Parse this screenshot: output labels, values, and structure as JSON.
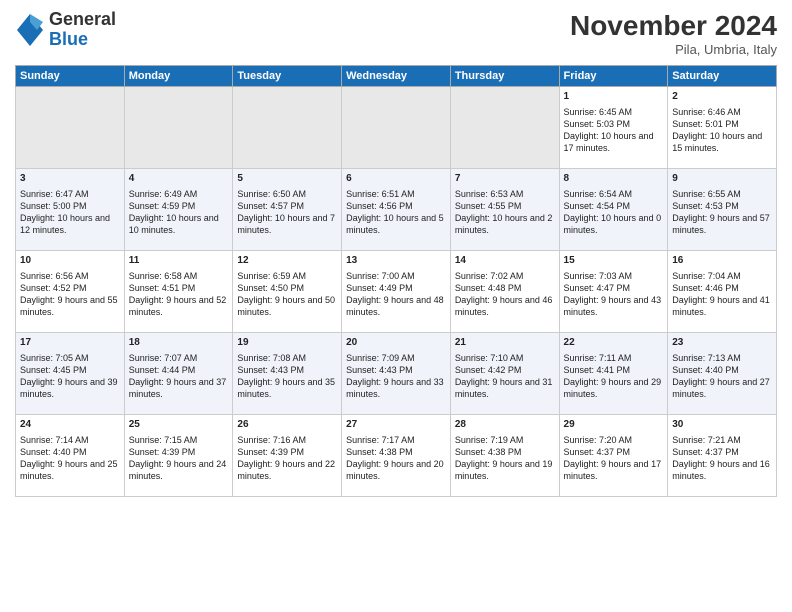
{
  "logo": {
    "general": "General",
    "blue": "Blue"
  },
  "header": {
    "title": "November 2024",
    "location": "Pila, Umbria, Italy"
  },
  "days_of_week": [
    "Sunday",
    "Monday",
    "Tuesday",
    "Wednesday",
    "Thursday",
    "Friday",
    "Saturday"
  ],
  "weeks": [
    [
      {
        "day": "",
        "info": ""
      },
      {
        "day": "",
        "info": ""
      },
      {
        "day": "",
        "info": ""
      },
      {
        "day": "",
        "info": ""
      },
      {
        "day": "",
        "info": ""
      },
      {
        "day": "1",
        "info": "Sunrise: 6:45 AM\nSunset: 5:03 PM\nDaylight: 10 hours and 17 minutes."
      },
      {
        "day": "2",
        "info": "Sunrise: 6:46 AM\nSunset: 5:01 PM\nDaylight: 10 hours and 15 minutes."
      }
    ],
    [
      {
        "day": "3",
        "info": "Sunrise: 6:47 AM\nSunset: 5:00 PM\nDaylight: 10 hours and 12 minutes."
      },
      {
        "day": "4",
        "info": "Sunrise: 6:49 AM\nSunset: 4:59 PM\nDaylight: 10 hours and 10 minutes."
      },
      {
        "day": "5",
        "info": "Sunrise: 6:50 AM\nSunset: 4:57 PM\nDaylight: 10 hours and 7 minutes."
      },
      {
        "day": "6",
        "info": "Sunrise: 6:51 AM\nSunset: 4:56 PM\nDaylight: 10 hours and 5 minutes."
      },
      {
        "day": "7",
        "info": "Sunrise: 6:53 AM\nSunset: 4:55 PM\nDaylight: 10 hours and 2 minutes."
      },
      {
        "day": "8",
        "info": "Sunrise: 6:54 AM\nSunset: 4:54 PM\nDaylight: 10 hours and 0 minutes."
      },
      {
        "day": "9",
        "info": "Sunrise: 6:55 AM\nSunset: 4:53 PM\nDaylight: 9 hours and 57 minutes."
      }
    ],
    [
      {
        "day": "10",
        "info": "Sunrise: 6:56 AM\nSunset: 4:52 PM\nDaylight: 9 hours and 55 minutes."
      },
      {
        "day": "11",
        "info": "Sunrise: 6:58 AM\nSunset: 4:51 PM\nDaylight: 9 hours and 52 minutes."
      },
      {
        "day": "12",
        "info": "Sunrise: 6:59 AM\nSunset: 4:50 PM\nDaylight: 9 hours and 50 minutes."
      },
      {
        "day": "13",
        "info": "Sunrise: 7:00 AM\nSunset: 4:49 PM\nDaylight: 9 hours and 48 minutes."
      },
      {
        "day": "14",
        "info": "Sunrise: 7:02 AM\nSunset: 4:48 PM\nDaylight: 9 hours and 46 minutes."
      },
      {
        "day": "15",
        "info": "Sunrise: 7:03 AM\nSunset: 4:47 PM\nDaylight: 9 hours and 43 minutes."
      },
      {
        "day": "16",
        "info": "Sunrise: 7:04 AM\nSunset: 4:46 PM\nDaylight: 9 hours and 41 minutes."
      }
    ],
    [
      {
        "day": "17",
        "info": "Sunrise: 7:05 AM\nSunset: 4:45 PM\nDaylight: 9 hours and 39 minutes."
      },
      {
        "day": "18",
        "info": "Sunrise: 7:07 AM\nSunset: 4:44 PM\nDaylight: 9 hours and 37 minutes."
      },
      {
        "day": "19",
        "info": "Sunrise: 7:08 AM\nSunset: 4:43 PM\nDaylight: 9 hours and 35 minutes."
      },
      {
        "day": "20",
        "info": "Sunrise: 7:09 AM\nSunset: 4:43 PM\nDaylight: 9 hours and 33 minutes."
      },
      {
        "day": "21",
        "info": "Sunrise: 7:10 AM\nSunset: 4:42 PM\nDaylight: 9 hours and 31 minutes."
      },
      {
        "day": "22",
        "info": "Sunrise: 7:11 AM\nSunset: 4:41 PM\nDaylight: 9 hours and 29 minutes."
      },
      {
        "day": "23",
        "info": "Sunrise: 7:13 AM\nSunset: 4:40 PM\nDaylight: 9 hours and 27 minutes."
      }
    ],
    [
      {
        "day": "24",
        "info": "Sunrise: 7:14 AM\nSunset: 4:40 PM\nDaylight: 9 hours and 25 minutes."
      },
      {
        "day": "25",
        "info": "Sunrise: 7:15 AM\nSunset: 4:39 PM\nDaylight: 9 hours and 24 minutes."
      },
      {
        "day": "26",
        "info": "Sunrise: 7:16 AM\nSunset: 4:39 PM\nDaylight: 9 hours and 22 minutes."
      },
      {
        "day": "27",
        "info": "Sunrise: 7:17 AM\nSunset: 4:38 PM\nDaylight: 9 hours and 20 minutes."
      },
      {
        "day": "28",
        "info": "Sunrise: 7:19 AM\nSunset: 4:38 PM\nDaylight: 9 hours and 19 minutes."
      },
      {
        "day": "29",
        "info": "Sunrise: 7:20 AM\nSunset: 4:37 PM\nDaylight: 9 hours and 17 minutes."
      },
      {
        "day": "30",
        "info": "Sunrise: 7:21 AM\nSunset: 4:37 PM\nDaylight: 9 hours and 16 minutes."
      }
    ]
  ]
}
